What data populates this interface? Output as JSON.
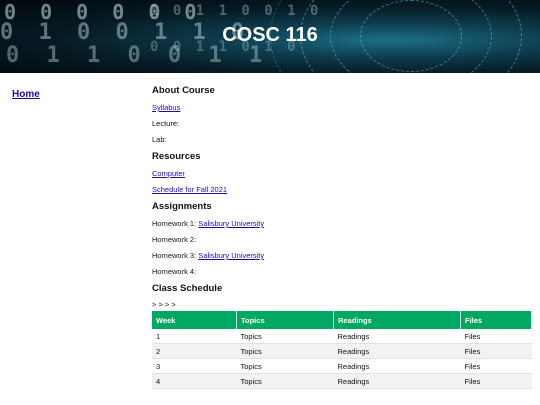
{
  "banner": {
    "title": "COSC 116"
  },
  "nav": {
    "home": "Home"
  },
  "about": {
    "heading": "About Course",
    "syllabus": "Syllabus",
    "lecture": "Lecture:",
    "lab": "Lab:"
  },
  "resources": {
    "heading": "Resources",
    "computer": "Computer",
    "schedule": "Schedule for Fall 2021"
  },
  "assignments": {
    "heading": "Assignments",
    "hw1_label": "Homework 1:",
    "hw1_link": "Salisbury University",
    "hw2_label": "Homework 2:",
    "hw3_label": "Homework 3:",
    "hw3_link": "Salisbury University",
    "hw4_label": "Homework 4:"
  },
  "class_schedule": {
    "heading": "Class Schedule",
    "nav_arrows": "> > > >",
    "columns": [
      "Week",
      "Topics",
      "Readings",
      "Files"
    ],
    "rows": [
      [
        "1",
        "Topics",
        "Readings",
        "Files"
      ],
      [
        "2",
        "Topics",
        "Readings",
        "Files"
      ],
      [
        "3",
        "Topics",
        "Readings",
        "Files"
      ],
      [
        "4",
        "Topics",
        "Readings",
        "Files"
      ]
    ]
  }
}
